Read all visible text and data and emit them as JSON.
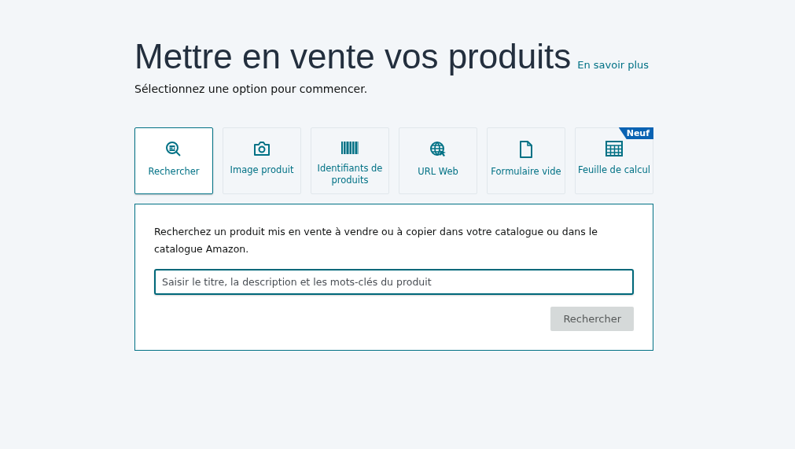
{
  "heading": {
    "title": "Mettre en vente vos produits",
    "link": "En savoir plus",
    "subtitle": "Sélectionnez une option pour commencer."
  },
  "options": [
    {
      "label": "Rechercher",
      "kind": "search",
      "selected": true
    },
    {
      "label": "Image produit",
      "kind": "camera",
      "selected": false
    },
    {
      "label": "Identifiants de produits",
      "kind": "barcode",
      "selected": false
    },
    {
      "label": "URL Web",
      "kind": "globe",
      "selected": false
    },
    {
      "label": "Formulaire vide",
      "kind": "document",
      "selected": false
    },
    {
      "label": "Feuille de calcul",
      "kind": "spreadsheet",
      "selected": false,
      "badge": "Neuf"
    }
  ],
  "panel": {
    "description": "Recherchez un produit mis en vente à vendre ou à copier dans votre catalogue ou dans le catalogue Amazon.",
    "search_placeholder": "Saisir le titre, la description et les mots-clés du produit",
    "button": {
      "label": "Rechercher",
      "disabled": true
    }
  }
}
